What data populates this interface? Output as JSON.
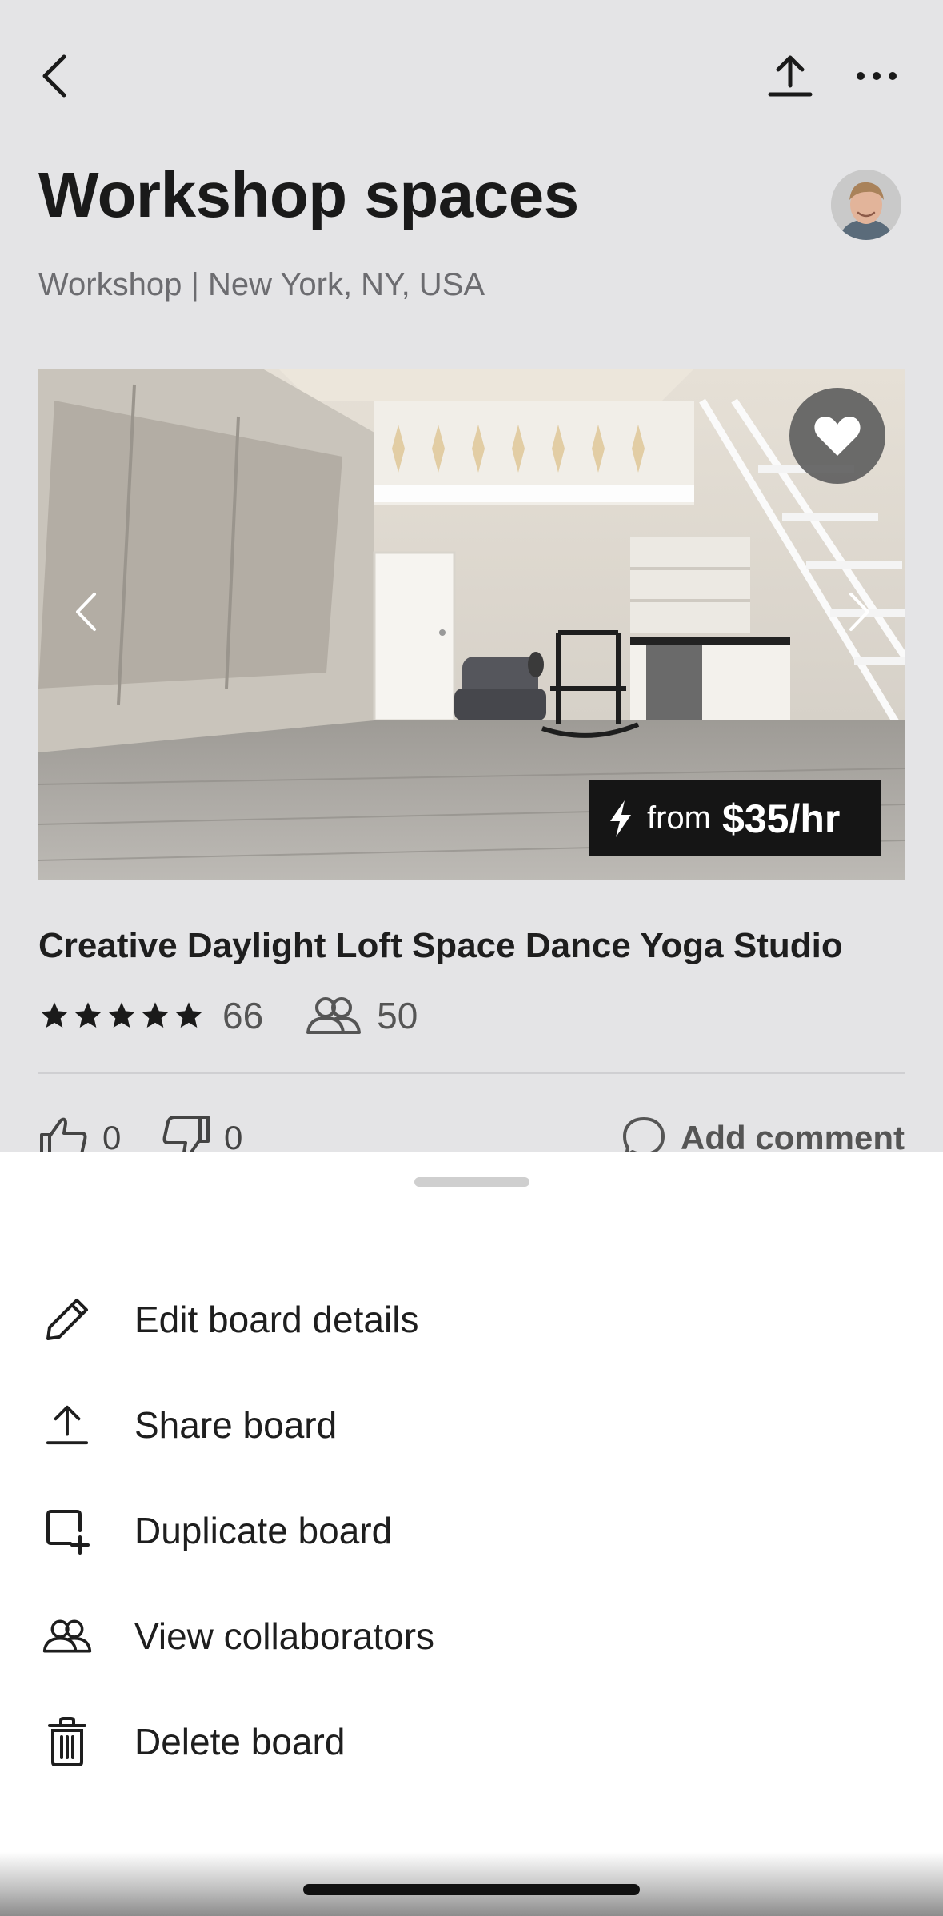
{
  "header": {
    "title": "Workshop spaces",
    "subtitle": "Workshop | New York, NY, USA",
    "icons": [
      "chevron-left-icon",
      "share-icon",
      "more-icon"
    ]
  },
  "listing": {
    "title": "Creative Daylight Loft Space Dance Yoga Studio",
    "price_from": "from",
    "price": "$35/hr",
    "rating_stars": 5,
    "rating_count": "66",
    "capacity": "50",
    "favorited": true
  },
  "reactions": {
    "likes": "0",
    "dislikes": "0",
    "add_comment": "Add comment"
  },
  "sheet": {
    "items": [
      {
        "label": "Edit board details",
        "icon": "pencil-icon"
      },
      {
        "label": "Share board",
        "icon": "share-icon"
      },
      {
        "label": "Duplicate board",
        "icon": "duplicate-icon"
      },
      {
        "label": "View collaborators",
        "icon": "people-icon"
      },
      {
        "label": "Delete board",
        "icon": "trash-icon"
      }
    ]
  },
  "colors": {
    "background_dimmed": "#e4e4e6",
    "sheet": "#ffffff",
    "badge": "#151515",
    "text_primary": "#1e1e1e",
    "text_secondary": "#6c6c70"
  }
}
